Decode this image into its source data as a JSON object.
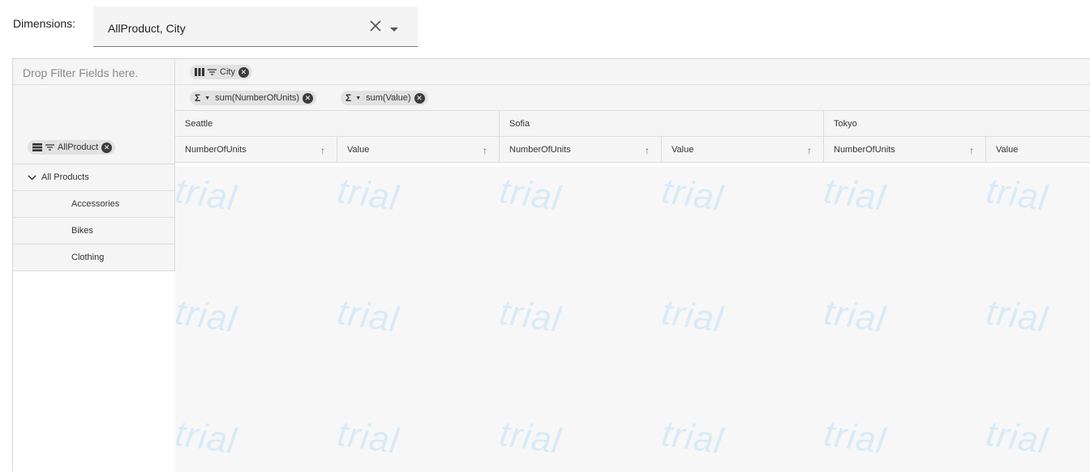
{
  "dimensions": {
    "label": "Dimensions:",
    "value": "AllProduct, City"
  },
  "icons": {
    "clear": "close-icon",
    "caret": "caret-down-icon",
    "columns": "columns-icon",
    "rows": "rows-icon",
    "filter": "filter-icon",
    "remove": "remove-icon",
    "sigma": "sigma-icon",
    "sort": "arrow-up-icon",
    "expand": "chevron-down-icon"
  },
  "pivot": {
    "filter_placeholder": "Drop Filter Fields here.",
    "column_chip": "City",
    "value_chips": [
      "sum(NumberOfUnits)",
      "sum(Value)"
    ],
    "row_chip": "AllProduct",
    "cities": [
      "Seattle",
      "Sofia",
      "Tokyo"
    ],
    "measures": [
      "NumberOfUnits",
      "Value",
      "NumberOfUnits",
      "Value",
      "NumberOfUnits",
      "Value"
    ],
    "rows": {
      "root": "All Products",
      "children": [
        "Accessories",
        "Bikes",
        "Clothing"
      ]
    },
    "watermark": "trial"
  }
}
